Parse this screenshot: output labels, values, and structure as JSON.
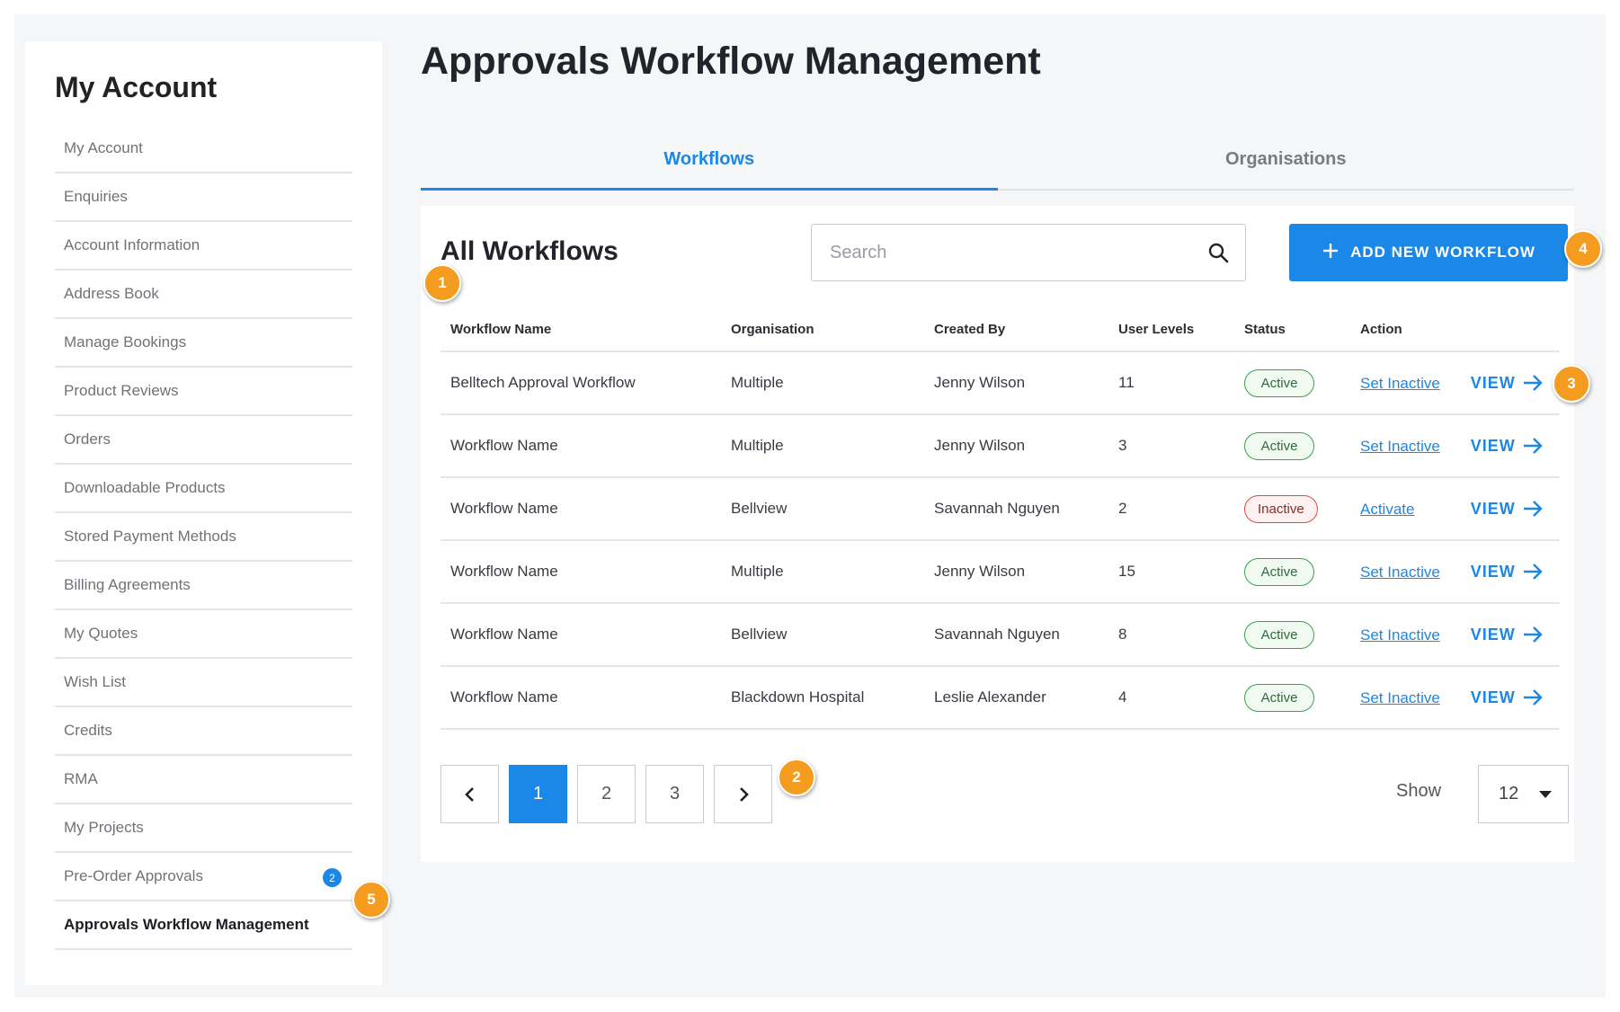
{
  "sidebar": {
    "title": "My Account",
    "items": [
      {
        "label": "My Account"
      },
      {
        "label": "Enquiries"
      },
      {
        "label": "Account Information"
      },
      {
        "label": "Address Book"
      },
      {
        "label": "Manage Bookings"
      },
      {
        "label": "Product Reviews"
      },
      {
        "label": "Orders"
      },
      {
        "label": "Downloadable Products"
      },
      {
        "label": "Stored Payment Methods"
      },
      {
        "label": "Billing Agreements"
      },
      {
        "label": "My Quotes"
      },
      {
        "label": "Wish List"
      },
      {
        "label": "Credits"
      },
      {
        "label": "RMA"
      },
      {
        "label": "My Projects"
      },
      {
        "label": "Pre-Order Approvals",
        "badge": "2"
      },
      {
        "label": "Approvals Workflow Management",
        "active": true
      }
    ]
  },
  "page": {
    "title": "Approvals Workflow Management"
  },
  "tabs": [
    {
      "label": "Workflows",
      "active": true
    },
    {
      "label": "Organisations",
      "active": false
    }
  ],
  "panel": {
    "title": "All Workflows",
    "search": {
      "placeholder": "Search",
      "value": ""
    },
    "add_button_label": "ADD NEW WORKFLOW"
  },
  "table": {
    "headers": [
      "Workflow Name",
      "Organisation",
      "Created By",
      "User Levels",
      "Status",
      "Action"
    ],
    "rows": [
      {
        "name": "Belltech Approval Workflow",
        "organisation": "Multiple",
        "created_by": "Jenny Wilson",
        "user_levels": "11",
        "status": "Active",
        "action": "Set Inactive",
        "view": "VIEW"
      },
      {
        "name": "Workflow Name",
        "organisation": "Multiple",
        "created_by": "Jenny Wilson",
        "user_levels": "3",
        "status": "Active",
        "action": "Set Inactive",
        "view": "VIEW"
      },
      {
        "name": "Workflow Name",
        "organisation": "Bellview",
        "created_by": "Savannah Nguyen",
        "user_levels": "2",
        "status": "Inactive",
        "action": "Activate",
        "view": "VIEW"
      },
      {
        "name": "Workflow Name",
        "organisation": "Multiple",
        "created_by": "Jenny Wilson",
        "user_levels": "15",
        "status": "Active",
        "action": "Set Inactive",
        "view": "VIEW"
      },
      {
        "name": "Workflow Name",
        "organisation": "Bellview",
        "created_by": "Savannah Nguyen",
        "user_levels": "8",
        "status": "Active",
        "action": "Set Inactive",
        "view": "VIEW"
      },
      {
        "name": "Workflow Name",
        "organisation": "Blackdown Hospital",
        "created_by": "Leslie Alexander",
        "user_levels": "4",
        "status": "Active",
        "action": "Set Inactive",
        "view": "VIEW"
      }
    ]
  },
  "pagination": {
    "pages": [
      "1",
      "2",
      "3"
    ],
    "current": "1",
    "show_label": "Show",
    "page_size": "12"
  },
  "markers": [
    "1",
    "2",
    "3",
    "4",
    "5"
  ],
  "colors": {
    "accent": "#1b87e6",
    "marker": "#f39c1f",
    "active_status": "#3aa14a",
    "inactive_status": "#e04848"
  },
  "icons": [
    "search-icon",
    "plus-icon",
    "arrow-right-icon",
    "chevron-left-icon",
    "chevron-right-icon",
    "caret-down-icon"
  ]
}
